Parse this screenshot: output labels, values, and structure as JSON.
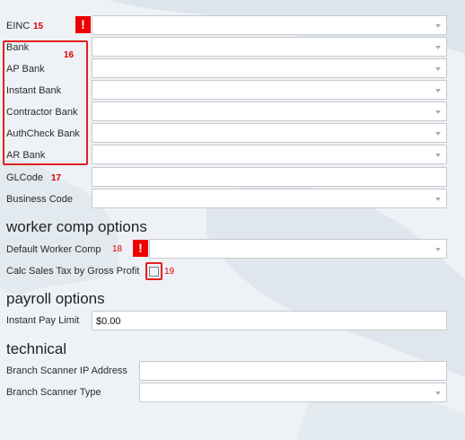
{
  "fields": {
    "einc": {
      "label": "EINC",
      "badge": "15"
    },
    "bank": {
      "label": "Bank",
      "badge": "16"
    },
    "ap_bank": {
      "label": "AP Bank"
    },
    "instant_bank": {
      "label": "Instant Bank"
    },
    "contractor_bank": {
      "label": "Contractor Bank"
    },
    "authcheck_bank": {
      "label": "AuthCheck Bank"
    },
    "ar_bank": {
      "label": "AR Bank"
    },
    "glcode": {
      "label": "GLCode",
      "badge": "17"
    },
    "business_code": {
      "label": "Business Code"
    }
  },
  "alert_glyph": "!",
  "sections": {
    "worker_comp": {
      "title": "worker comp options",
      "default_worker_comp": {
        "label": "Default Worker Comp",
        "badge": "18"
      },
      "calc_sales_tax": {
        "label": "Calc Sales Tax by Gross Profit",
        "badge": "19",
        "checked": false
      }
    },
    "payroll": {
      "title": "payroll options",
      "instant_pay_limit": {
        "label": "Instant Pay Limit",
        "value": "$0.00"
      }
    },
    "technical": {
      "title": "technical",
      "scanner_ip": {
        "label": "Branch Scanner IP Address",
        "value": ""
      },
      "scanner_type": {
        "label": "Branch Scanner Type"
      }
    }
  },
  "colors": {
    "alert": "#ee0000",
    "highlight_border": "#e12020",
    "background": "#eef2f6"
  }
}
